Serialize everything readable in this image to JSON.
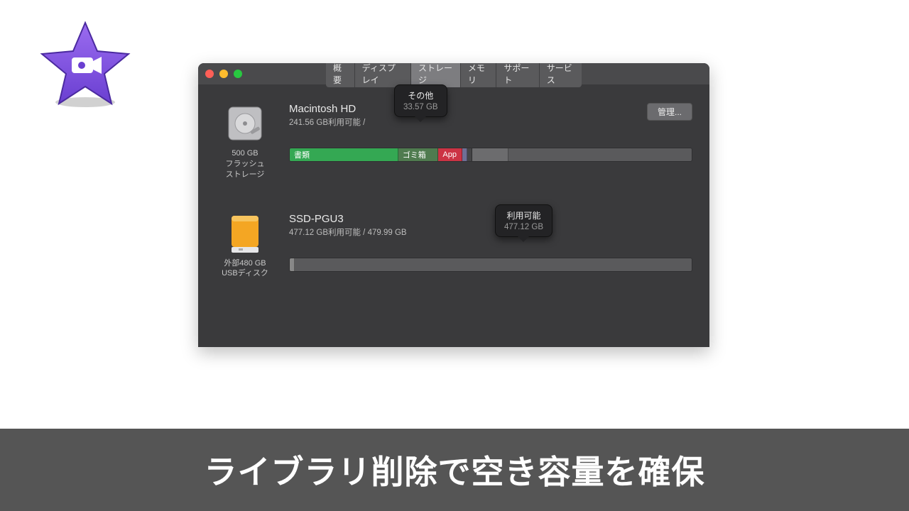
{
  "tabs": [
    "概要",
    "ディスプレイ",
    "ストレージ",
    "メモリ",
    "サポート",
    "サービス"
  ],
  "activeTab": "ストレージ",
  "manageLabel": "管理...",
  "drives": [
    {
      "name": "Macintosh HD",
      "sub": "241.56 GB利用可能 /",
      "caption": "500 GB\nフラッシュ\nストレージ",
      "tooltip": {
        "title": "その他",
        "value": "33.57 GB"
      },
      "segments": [
        {
          "label": "書類",
          "color": "#34a853",
          "width": 27
        },
        {
          "label": "ゴミ箱",
          "color": "#4f7b4f",
          "width": 10
        },
        {
          "label": "App",
          "color": "#cc3344",
          "width": 6
        },
        {
          "label": "",
          "color": "#6f6f95",
          "width": 1.2
        },
        {
          "label": "",
          "color": "#444446",
          "width": 1.2
        },
        {
          "label": "",
          "color": "#6c6c6e",
          "width": 9
        }
      ]
    },
    {
      "name": "SSD-PGU3",
      "sub": "477.12 GB利用可能 / 479.99 GB",
      "caption": "外部480 GB\nUSBディスク",
      "tooltip": {
        "title": "利用可能",
        "value": "477.12 GB"
      },
      "segments": [
        {
          "label": "",
          "color": "#888",
          "width": 0.6
        }
      ]
    }
  ],
  "banner": "ライブラリ削除で空き容量を確保"
}
